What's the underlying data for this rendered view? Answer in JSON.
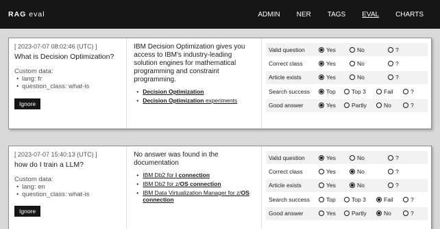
{
  "brand": {
    "bold": "RAG",
    "rest": "eval"
  },
  "nav": [
    {
      "label": "ADMIN",
      "active": false
    },
    {
      "label": "NER",
      "active": false
    },
    {
      "label": "TAGS",
      "active": false
    },
    {
      "label": "EVAL",
      "active": true
    },
    {
      "label": "CHARTS",
      "active": false
    }
  ],
  "ignore_label": "Ignore",
  "custom_label": "Custom data:",
  "cards": [
    {
      "timestamp": "[ 2023-07-07 08:02:46 (UTC) ]",
      "question": "What is Decision Optimization?",
      "custom": [
        "lang: fr",
        "question_class: what-is"
      ],
      "answer": "IBM Decision Optimization gives you access to IBM's industry-leading solution engines for mathematical programming and constraint programming.",
      "links": [
        {
          "parts": [
            {
              "t": "Decision Optimization",
              "b": true
            }
          ]
        },
        {
          "parts": [
            {
              "t": "Decision Optimization",
              "b": true
            },
            {
              "t": " experiments",
              "b": false
            }
          ]
        }
      ],
      "ratings": [
        {
          "label": "Valid question",
          "options": [
            "Yes",
            "No",
            "?"
          ],
          "selected": 0
        },
        {
          "label": "Correct class",
          "options": [
            "Yes",
            "No",
            "?"
          ],
          "selected": 0
        },
        {
          "label": "Article exists",
          "options": [
            "Yes",
            "No",
            "?"
          ],
          "selected": 0
        },
        {
          "label": "Search success",
          "options": [
            "Top",
            "Top 3",
            "Fail",
            "?"
          ],
          "selected": 0
        },
        {
          "label": "Good answer",
          "options": [
            "Yes",
            "Partly",
            "No",
            "?"
          ],
          "selected": 0
        }
      ]
    },
    {
      "timestamp": "[ 2023-07-07 15:40:13 (UTC) ]",
      "question": "how do I train a LLM?",
      "custom": [
        "lang: en",
        "question_class: what-is"
      ],
      "answer": "No answer was found in the documentation",
      "links": [
        {
          "parts": [
            {
              "t": "IBM Db2 for ",
              "b": false
            },
            {
              "t": "i",
              "b": true
            },
            {
              "t": " ",
              "b": false
            },
            {
              "t": "connection",
              "b": true
            }
          ]
        },
        {
          "parts": [
            {
              "t": "IBM Db2 for z/",
              "b": false
            },
            {
              "t": "OS connection",
              "b": true
            }
          ]
        },
        {
          "parts": [
            {
              "t": "IBM Data Virtualization Manager for z/",
              "b": false
            },
            {
              "t": "OS connection",
              "b": true
            }
          ]
        }
      ],
      "ratings": [
        {
          "label": "Valid question",
          "options": [
            "Yes",
            "No",
            "?"
          ],
          "selected": 0
        },
        {
          "label": "Correct class",
          "options": [
            "Yes",
            "No",
            "?"
          ],
          "selected": 1
        },
        {
          "label": "Article exists",
          "options": [
            "Yes",
            "No",
            "?"
          ],
          "selected": 1
        },
        {
          "label": "Search success",
          "options": [
            "Top",
            "Top 3",
            "Fail",
            "?"
          ],
          "selected": 2
        },
        {
          "label": "Good answer",
          "options": [
            "Yes",
            "Partly",
            "No",
            "?"
          ],
          "selected": 2
        }
      ]
    }
  ]
}
